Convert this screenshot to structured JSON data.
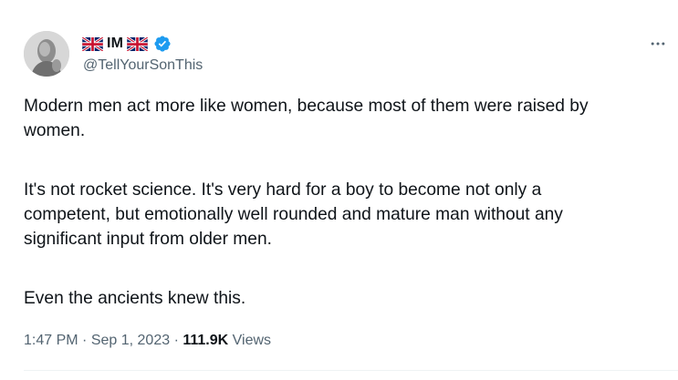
{
  "author": {
    "display_name": "IM",
    "handle": "@TellYourSonThis",
    "flag_icon": "uk-flag-icon",
    "verified_icon": "verified-badge-icon"
  },
  "tweet": {
    "paragraphs": [
      [
        "Modern men act more like women, because most of them were raised by",
        "women."
      ],
      [
        "It's not rocket science. It's very hard for a boy to become not only a",
        "competent, but emotionally well rounded and mature man without any",
        "significant input from older men."
      ],
      [
        "Even the ancients knew this."
      ]
    ]
  },
  "meta": {
    "time": "1:47 PM",
    "separator": "·",
    "date": "Sep 1, 2023",
    "views_count": "111.9K",
    "views_label": "Views"
  },
  "colors": {
    "text": "#0f1419",
    "secondary": "#536471",
    "verified": "#1d9bf0",
    "divider": "#eff3f4"
  }
}
